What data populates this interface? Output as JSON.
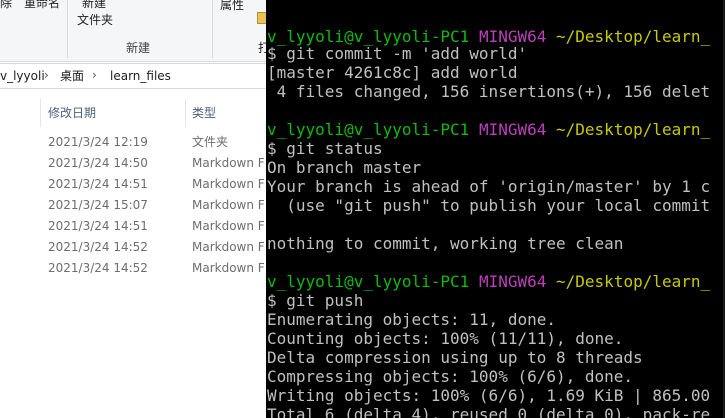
{
  "explorer": {
    "ribbon": {
      "delete_label": "除",
      "rename_label": "重命名",
      "new_label": "新建",
      "new_folder_label": "文件夹",
      "new_group_label": "新建",
      "properties_label": "属性",
      "open_partial_label": "打"
    },
    "breadcrumb": {
      "user": "v_lyyoli",
      "desktop": "桌面",
      "folder": "learn_files",
      "separator": "›"
    },
    "columns": {
      "date": "修改日期",
      "type": "类型"
    },
    "files": [
      {
        "date": "2021/3/24 12:19",
        "type": "文件夹"
      },
      {
        "date": "2021/3/24 14:50",
        "type": "Markdown F"
      },
      {
        "date": "2021/3/24 14:51",
        "type": "Markdown F"
      },
      {
        "date": "2021/3/24 15:07",
        "type": "Markdown F"
      },
      {
        "date": "2021/3/24 14:51",
        "type": "Markdown F"
      },
      {
        "date": "2021/3/24 14:52",
        "type": "Markdown F"
      },
      {
        "date": "2021/3/24 14:52",
        "type": "Markdown F"
      }
    ]
  },
  "terminal": {
    "prompt": {
      "user_host": "v_lyyoli@v_lyyoli-PC1",
      "env": "MINGW64",
      "path": "~/Desktop/learn_"
    },
    "lines": [
      "$ git commit -m 'add world'",
      "[master 4261c8c] add world",
      " 4 files changed, 156 insertions(+), 156 delet",
      "",
      "$ git status",
      "On branch master",
      "Your branch is ahead of 'origin/master' by 1 c",
      "  (use \"git push\" to publish your local commit",
      "",
      "nothing to commit, working tree clean",
      "",
      "$ git push",
      "Enumerating objects: 11, done.",
      "Counting objects: 100% (11/11), done.",
      "Delta compression using up to 8 threads",
      "Compressing objects: 100% (6/6), done.",
      "Writing objects: 100% (6/6), 1.69 KiB | 865.00",
      "Total 6 (delta 4), reused 0 (delta 0), pack-re"
    ],
    "colors": {
      "background": "#000000",
      "text": "#c0c0c0",
      "user_host": "#0dbc0d",
      "env": "#bc3fbc",
      "path": "#c9c900"
    }
  }
}
